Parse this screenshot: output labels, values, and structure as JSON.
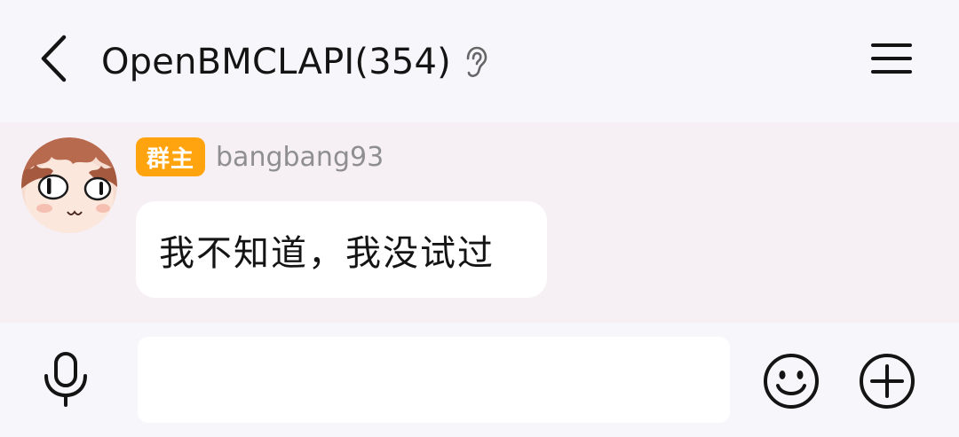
{
  "header": {
    "back_icon": "chevron-left-icon",
    "title": "OpenBMCLAPI(354)",
    "ear_icon": "ear-icon",
    "menu_icon": "hamburger-menu-icon"
  },
  "message": {
    "avatar_icon": "anime-avatar",
    "role_badge": "群主",
    "sender_name": "bangbang93",
    "text": "我不知道，我没试过",
    "badge_color": "#ffa40e"
  },
  "input_bar": {
    "voice_icon": "microphone-icon",
    "input_value": "",
    "input_placeholder": "",
    "emoji_icon": "smiley-icon",
    "plus_icon": "plus-circle-icon"
  }
}
